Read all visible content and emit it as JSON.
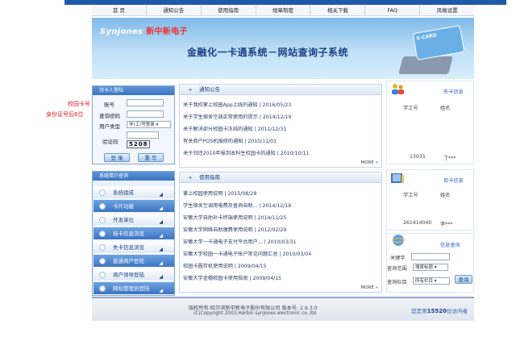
{
  "nav": [
    "首 页",
    "通知公告",
    "使用指南",
    "规章制度",
    "相关下载",
    "FAQ",
    "风格设置"
  ],
  "banner": {
    "logo_text": "Synjones",
    "logo_cn": "新中新电子",
    "system_name": "金融化一卡通系统－网站查询子系统",
    "card_label": "E-CARD"
  },
  "annotations": {
    "line1": "校园卡号",
    "line2": "身份证号后6位"
  },
  "login": {
    "header": "持卡人登陆",
    "account_label": "账号",
    "password_label": "查询密码",
    "usertype_label": "用户类型",
    "usertype_value": "学(工)号登录",
    "captcha_label": "验证码",
    "captcha_value": "5208",
    "login_button": "登 录",
    "reset_button": "重 写"
  },
  "menu": {
    "header": "系统简介查询",
    "items": [
      "系统组成",
      "卡片功能",
      "开发单位",
      "持卡信息浏览",
      "失卡信息浏览",
      "普通商户登陆",
      "商户领导登陆",
      "网站管理员登陆"
    ]
  },
  "notice": {
    "title": "通知公告",
    "items": [
      "关于我校掌上校园App上线的通知 | 2016/05/23",
      "关于学生宿舍空调正常使用的提示 | 2014/12/19",
      "关于解决部分校园卡冻结的通知 | 2011/12/31",
      "有关商户POS机报修的通知 | 2010/11/01",
      "关于归还2010年报到本科生校园卡的通知 | 2010/10/11"
    ],
    "more": "MORE »"
  },
  "guide": {
    "title": "使用指南",
    "items": [
      "掌上校园使用说明 | 2015/08/28",
      "学生宿舍空调用电费及查询自助... | 2014/12/19",
      "安徽大学自助补卡终端使用说明 | 2014/11/25",
      "安徽大学网络自助缴费使用说明 | 2012/02/29",
      "安徽大学一卡通电子支付平台用户... | 2010/03/31",
      "安徽大学校园一卡通电子账户常见问题汇总 | 2010/03/04",
      "校园卡圈存机使用说明 | 2009/04/15",
      "安徽大学金穗校园卡使用指南 | 2009/04/15"
    ],
    "more": "MORE »"
  },
  "lost_card": {
    "title": "失卡信息",
    "col1": "学工号",
    "col2": "姓名",
    "id": "13035",
    "name": "丁***"
  },
  "found_card": {
    "title": "拾卡信息",
    "col1": "学工号",
    "col2": "姓名",
    "id": "261414040",
    "name": "李***"
  },
  "search": {
    "title": "信息查询",
    "keyword_label": "关键字",
    "scope_label": "查询范围",
    "scope_value": "搜索标题",
    "column_label": "查询栏目",
    "column_value": "所有栏目",
    "button": "查询"
  },
  "footer": {
    "copyright_cn": "版权所有:哈尔滨新中新电子股份有限公司 版本号: 2.6.3.0",
    "copyright_en": "(C)Copyright 2003,Harbin synjones electronic co.,ltd",
    "visit_prefix": "您是第",
    "visit_count": "15520",
    "visit_suffix": "位访问者"
  },
  "colors": {
    "brand_blue": "#1f5aa8",
    "accent_red": "#e02020",
    "panel_border": "#c4d4ea"
  }
}
